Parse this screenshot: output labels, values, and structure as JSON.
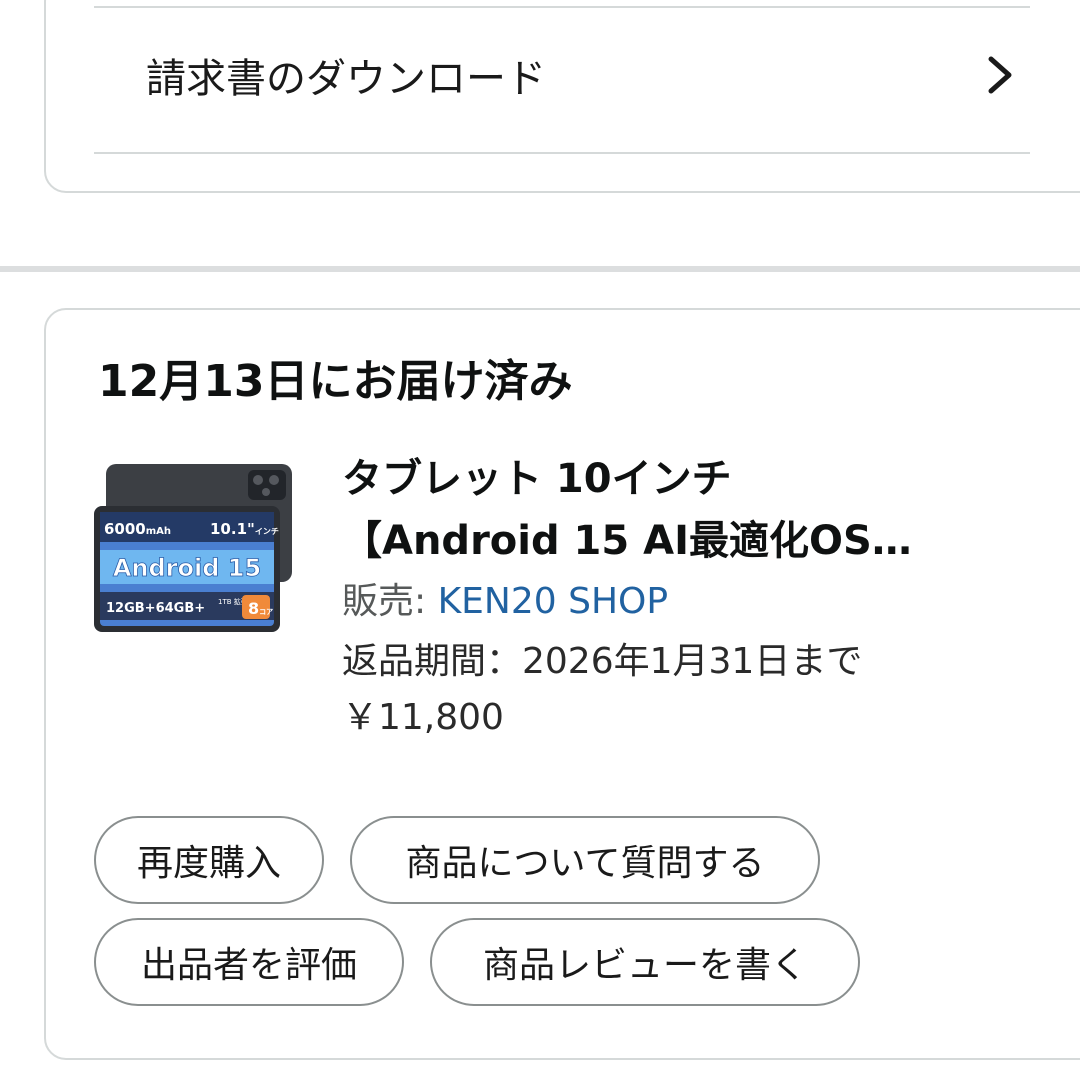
{
  "invoice": {
    "label": "請求書のダウンロード",
    "chevron_icon": "chevron-right-icon"
  },
  "order": {
    "delivery_status": "12月13日にお届け済み",
    "product": {
      "title": "タブレット 10インチ\n【Android 15 AI最適化OS…",
      "image": {
        "icon": "tablet-product-image",
        "badge_battery": "6000",
        "badge_battery_unit": "mAh",
        "badge_size": "10.1\"",
        "badge_size_unit": "インチ",
        "badge_os": "Android 15",
        "badge_memory": "12GB+64GB+",
        "badge_storage_note": "1TB\n拡張",
        "badge_cores": "8",
        "badge_cores_unit": "コア"
      },
      "seller_prefix": "販売: ",
      "seller_name": "KEN20 SHOP",
      "return_period": "返品期間：2026年1月31日まで",
      "price": "￥11,800"
    },
    "actions": {
      "buy_again": "再度購入",
      "ask_question": "商品について質問する",
      "rate_seller": "出品者を評価",
      "write_review": "商品レビューを書く"
    }
  },
  "colors": {
    "link": "#2162a1",
    "border": "#d5d9d9",
    "pill_border": "#8a8f8f"
  }
}
